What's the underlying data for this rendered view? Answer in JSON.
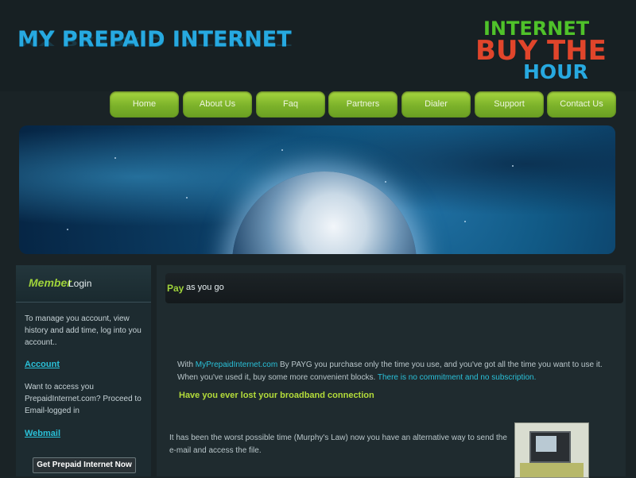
{
  "header": {
    "site_title": "MY PREPAID INTERNET",
    "logo_line1": "INTERNET",
    "logo_line2": "BUY THE",
    "logo_line3": "HOUR"
  },
  "nav": {
    "items": [
      "Home",
      "About Us",
      "Faq",
      "Partners",
      "Dialer",
      "Support",
      "Contact Us"
    ]
  },
  "sidebar": {
    "title_accent": "Member",
    "title_rest": "Login",
    "text1": "To manage you account,  view history and add time, log into you account..",
    "link1": "Account",
    "text2": "Want to access you PrepaidInternet.com? Proceed to Email-logged in",
    "link2": "Webmail",
    "button": "Get Prepaid Internet Now"
  },
  "main": {
    "title_accent": "Pay",
    "title_rest": "as you go",
    "para1_pre": "With ",
    "para1_link": "MyPrepaidInternet.com",
    "para1_mid": " By PAYG you purchase only the time you use, and you've got all the time you want to use it. When you've used it, buy some more convenient blocks. ",
    "para1_hl": "There is no commitment and no subscription.",
    "subhead": "Have you ever lost your broadband connection",
    "para2": "It has been the worst possible time (Murphy's Law) now you have an alternative way to send the e-mail and access the file."
  },
  "colors": {
    "accent_green": "#9fd33b",
    "accent_blue": "#27a9e0",
    "link_cyan": "#2ac0d8",
    "logo_red": "#e0452b"
  }
}
